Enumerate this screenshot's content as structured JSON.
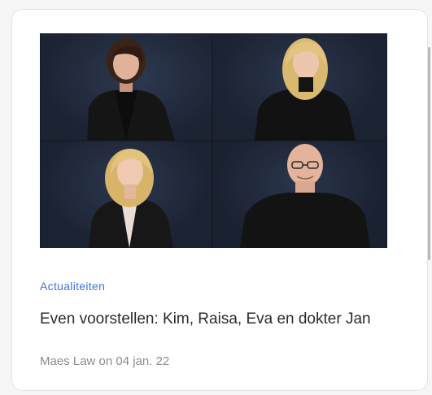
{
  "article_card": {
    "category": "Actualiteiten",
    "title": "Even voorstellen: Kim, Raisa, Eva en dokter Jan",
    "meta": "Maes Law on 04 jan. 22",
    "image": {
      "portraits": [
        "woman-dark-hair",
        "woman-blonde-hair",
        "woman-blonde-wavy-hair",
        "bald-man-glasses"
      ]
    }
  },
  "colors": {
    "accent": "#3f74d6",
    "photo_background": "#1d2536",
    "title_text": "#2b2b2b",
    "meta_text": "#8b8b8b"
  }
}
